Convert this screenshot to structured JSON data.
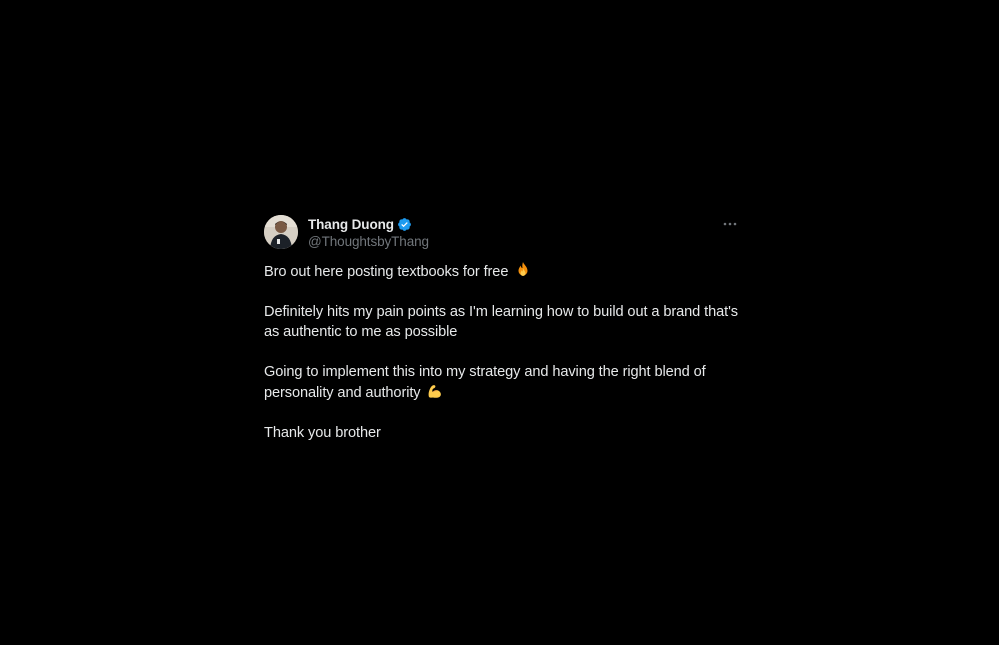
{
  "tweet": {
    "author": {
      "display_name": "Thang Duong",
      "handle": "@ThoughtsbyThang",
      "verified": true,
      "verified_color": "#1d9bf0",
      "avatar_icon": "user-avatar-photo"
    },
    "more_icon": "more-horizontal-icon",
    "paragraphs": [
      {
        "text": "Bro out here posting textbooks for free",
        "emoji": "fire-emoji"
      },
      {
        "text": "Definitely hits my pain points as I'm learning how to build out a brand that's as authentic to me as possible",
        "emoji": null
      },
      {
        "text": "Going to implement this into my strategy and having the right blend of personality and authority",
        "emoji": "flexed-biceps-emoji"
      },
      {
        "text": "Thank you brother",
        "emoji": null
      }
    ]
  },
  "colors": {
    "background": "#000000",
    "text_primary": "#e7e9ea",
    "text_secondary": "#71767b"
  }
}
